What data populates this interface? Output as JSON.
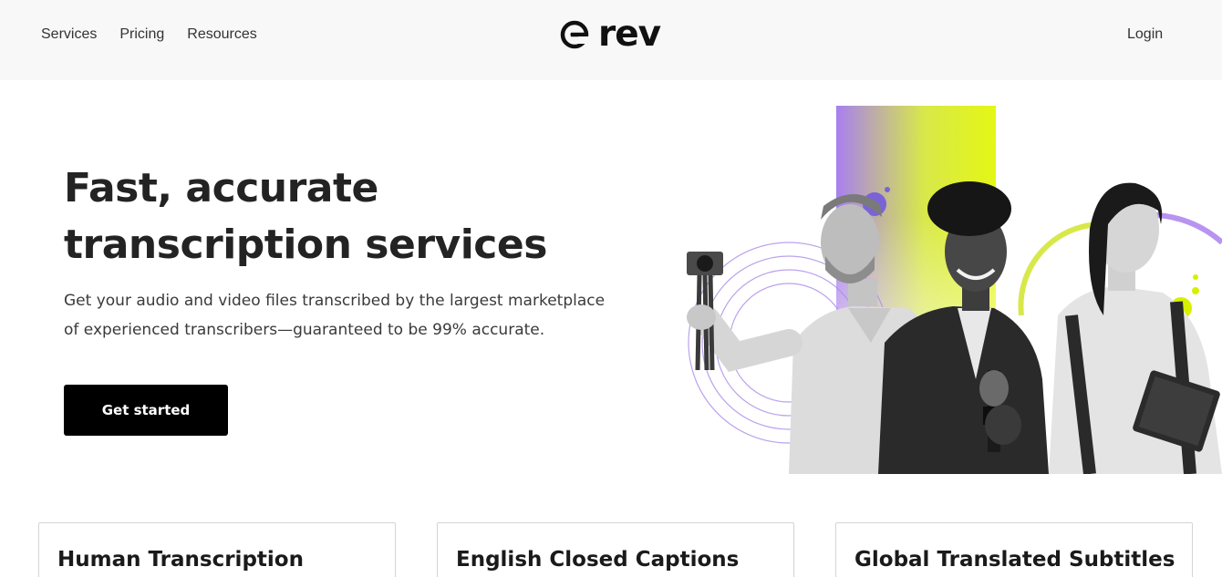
{
  "header": {
    "nav": [
      {
        "label": "Services"
      },
      {
        "label": "Pricing"
      },
      {
        "label": "Resources"
      }
    ],
    "logo_text": "rev",
    "login_label": "Login"
  },
  "hero": {
    "title_line1": "Fast, accurate",
    "title_line2": "transcription services",
    "subtitle_line1": "Get your audio and video files transcribed by the largest marketplace",
    "subtitle_line2": "of experienced transcribers—guaranteed to be 99% accurate.",
    "cta_label": "Get started"
  },
  "cards": [
    {
      "title": "Human Transcription"
    },
    {
      "title": "English Closed Captions"
    },
    {
      "title": "Global Translated Subtitles"
    }
  ],
  "colors": {
    "header_bg": "#f8f8f8",
    "cta_bg": "#000000",
    "accent_purple": "#a87ff0",
    "accent_lime": "#e4f714"
  }
}
